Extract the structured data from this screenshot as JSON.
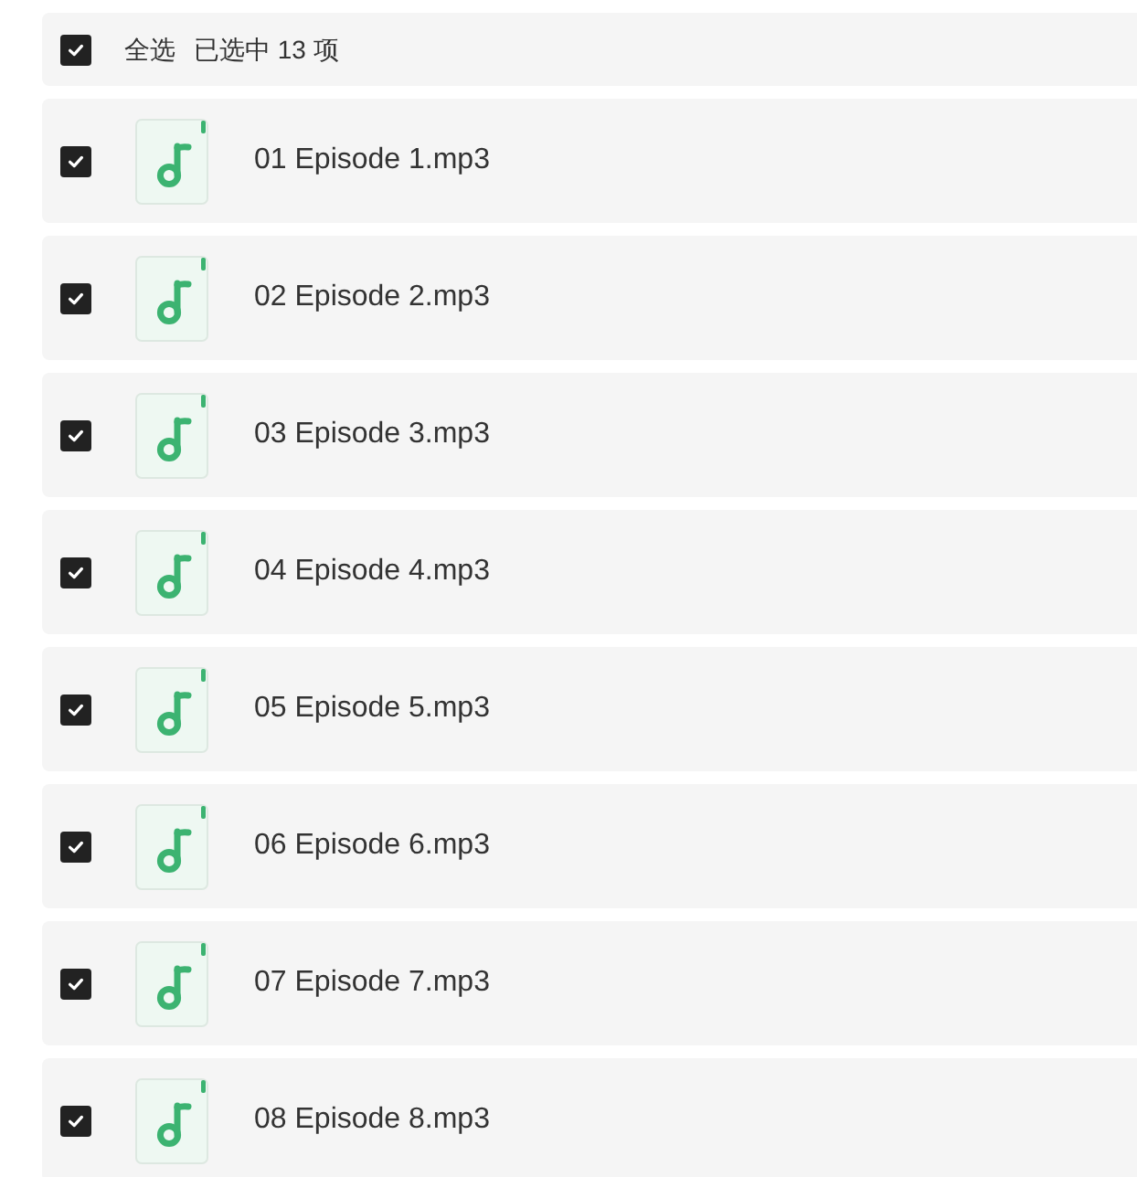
{
  "header": {
    "checked": true,
    "select_all_label": "全选",
    "selected_count": "已选中 13 项"
  },
  "files": [
    {
      "name": "01 Episode 1.mp3",
      "checked": true
    },
    {
      "name": "02 Episode 2.mp3",
      "checked": true
    },
    {
      "name": "03 Episode 3.mp3",
      "checked": true
    },
    {
      "name": "04 Episode 4.mp3",
      "checked": true
    },
    {
      "name": "05 Episode 5.mp3",
      "checked": true
    },
    {
      "name": "06 Episode 6.mp3",
      "checked": true
    },
    {
      "name": "07 Episode 7.mp3",
      "checked": true
    },
    {
      "name": "08 Episode 8.mp3",
      "checked": true
    }
  ]
}
